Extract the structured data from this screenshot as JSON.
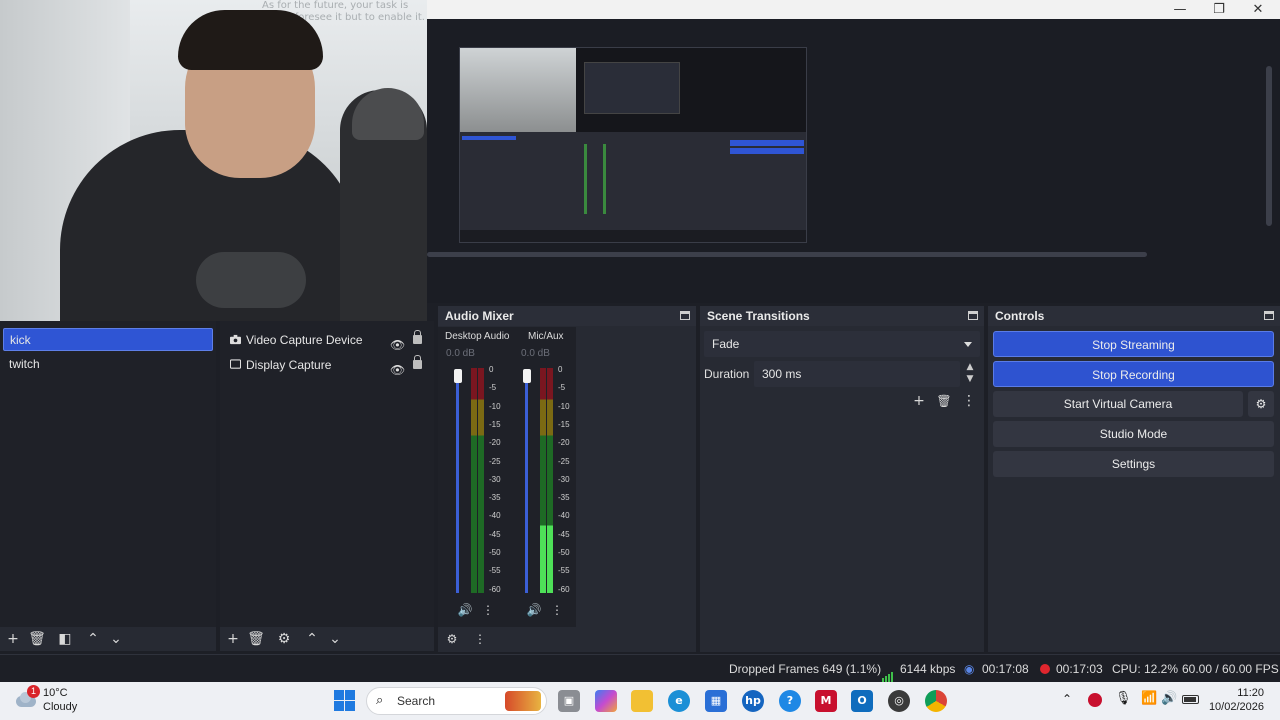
{
  "window": {
    "minimize": "—",
    "maximize": "❐",
    "close": "✕"
  },
  "scenes": {
    "items": [
      {
        "label": "kick",
        "active": true
      },
      {
        "label": "twitch",
        "active": false
      }
    ]
  },
  "sources": {
    "items": [
      {
        "label": "Video Capture Device",
        "icon": "camera-icon"
      },
      {
        "label": "Display Capture",
        "icon": "monitor-icon"
      }
    ]
  },
  "audio_mixer": {
    "title": "Audio Mixer",
    "channels": [
      {
        "name": "Desktop Audio",
        "db": "0.0 dB",
        "level": 0
      },
      {
        "name": "Mic/Aux",
        "db": "0.0 dB",
        "level": 0.3
      }
    ],
    "ticks": [
      "0",
      "-5",
      "-10",
      "-15",
      "-20",
      "-25",
      "-30",
      "-35",
      "-40",
      "-45",
      "-50",
      "-55",
      "-60"
    ]
  },
  "transitions": {
    "title": "Scene Transitions",
    "selected": "Fade",
    "duration_label": "Duration",
    "duration_value": "300 ms"
  },
  "controls": {
    "title": "Controls",
    "stop_streaming": "Stop Streaming",
    "stop_recording": "Stop Recording",
    "start_virtual_camera": "Start Virtual Camera",
    "studio_mode": "Studio Mode",
    "settings": "Settings"
  },
  "status": {
    "dropped_frames": "Dropped Frames 649 (1.1%)",
    "bitrate": "6144 kbps",
    "stream_time": "00:17:08",
    "record_time": "00:17:03",
    "cpu": "CPU: 12.2%",
    "fps": "60.00 / 60.00 FPS"
  },
  "taskbar": {
    "weather_temp": "10°C",
    "weather_desc": "Cloudy",
    "weather_badge": "1",
    "search_placeholder": "Search",
    "time": "11:20",
    "date": "10/02/2026"
  },
  "webcam_text": "As for the future, your task is not to foresee it but to enable it.",
  "colors": {
    "accent": "#2e53d0",
    "panel": "#272a33",
    "background": "#1d1f26",
    "taskbar": "#eef0f4"
  }
}
